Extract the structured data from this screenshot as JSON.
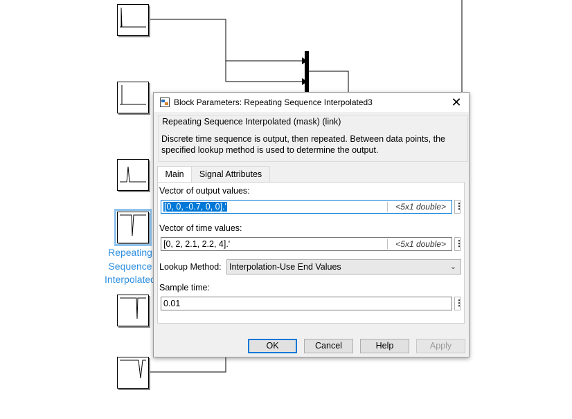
{
  "diagram": {
    "selected_block_label": "Repeating Sequence Interpolated"
  },
  "dialog": {
    "title": "Block Parameters: Repeating Sequence Interpolated3",
    "group_title": "Repeating Sequence Interpolated (mask) (link)",
    "description": "Discrete time sequence is output, then repeated. Between data points, the specified lookup method is used to determine the output.",
    "tabs": [
      {
        "label": "Main",
        "active": true
      },
      {
        "label": "Signal Attributes",
        "active": false
      }
    ],
    "output_values": {
      "label": "Vector of output values:",
      "value": "[0, 0, -0.7, 0, 0].'",
      "dim": "<5x1 double>"
    },
    "time_values": {
      "label": "Vector of time values:",
      "value": "[0, 2, 2.1, 2.2, 4].'",
      "dim": "<5x1 double>"
    },
    "lookup_method": {
      "label": "Lookup Method:",
      "value": "Interpolation-Use End Values"
    },
    "sample_time": {
      "label": "Sample time:",
      "value": "0.01"
    },
    "buttons": {
      "ok": "OK",
      "cancel": "Cancel",
      "help": "Help",
      "apply": "Apply"
    }
  },
  "colors": {
    "selection_outline": "#8fc3ee",
    "block_label": "#2a8ee0",
    "text_selection": "#0078d7"
  }
}
